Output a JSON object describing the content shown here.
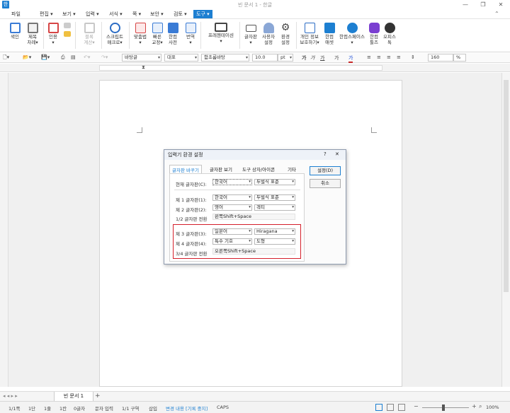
{
  "window": {
    "title": "빈 문서 1 - 한글"
  },
  "menu": [
    {
      "label": "파일"
    },
    {
      "label": "편집 ▾"
    },
    {
      "label": "보기 ▾"
    },
    {
      "label": "입력 ▾"
    },
    {
      "label": "서식 ▾"
    },
    {
      "label": "쪽 ▾"
    },
    {
      "label": "보안 ▾"
    },
    {
      "label": "검토 ▾"
    },
    {
      "label": "도구 ▾"
    }
  ],
  "ribbon": [
    {
      "label": "색인",
      "icon": "index-icon",
      "color": "#3a7bd5"
    },
    {
      "label": "제목\n차례▾",
      "icon": "toc-icon",
      "color": "#6a6a6a"
    },
    {
      "label": "인용\n▾",
      "icon": "quote-icon",
      "color": "#d64545"
    },
    {
      "label": "블록\n계산▾",
      "icon": "block-calc-icon",
      "color": "#b8b8b8"
    },
    {
      "label": "스크립트\n매크로▾",
      "icon": "script-icon",
      "color": "#2b6cc4"
    },
    {
      "label": "맞춤법\n▾",
      "icon": "spellcheck-icon",
      "color": "#d64545"
    },
    {
      "label": "빠른\n교정▾",
      "icon": "quick-correct-icon",
      "color": "#3a7bd5"
    },
    {
      "label": "한컴\n사전",
      "icon": "dictionary-icon",
      "color": "#3a7bd5"
    },
    {
      "label": "번역\n▾",
      "icon": "translate-icon",
      "color": "#3a7bd5"
    },
    {
      "label": "프레젠테이션\n▾",
      "icon": "presentation-icon",
      "color": "#444444"
    },
    {
      "label": "글자판\n▾",
      "icon": "keyboard-icon",
      "color": "#555555"
    },
    {
      "label": "사용자\n설정",
      "icon": "user-settings-icon",
      "color": "#3a7bd5"
    },
    {
      "label": "환경\n설정",
      "icon": "gear-icon",
      "color": "#444444"
    },
    {
      "label": "개인 정보\n보호하기▾",
      "icon": "privacy-icon",
      "color": "#2b6cc4"
    },
    {
      "label": "한컴\n애셋",
      "icon": "hancom-asset-icon",
      "color": "#1d7fd1"
    },
    {
      "label": "한컴스페이스\n▾",
      "icon": "hancom-space-icon",
      "color": "#1d7fd1"
    },
    {
      "label": "한컴\n툴즈",
      "icon": "hancom-tools-icon",
      "color": "#7a3fd1"
    },
    {
      "label": "오피스\n톡",
      "icon": "office-talk-icon",
      "color": "#333333"
    }
  ],
  "format": {
    "style": "바탕글",
    "lang": "대표",
    "font": "함초롬바탕",
    "size": "10.0",
    "unit": "pt",
    "zoom": "160",
    "zoom_unit": "%",
    "bold": "가",
    "italic": "가",
    "underline": "가",
    "strike": "가",
    "color": "가"
  },
  "tabs": {
    "doc": "빈 문서 1",
    "add": "+"
  },
  "status": [
    "1/1쪽",
    "1단",
    "1줄",
    "1칸",
    "0글자",
    "문자 입력",
    "1/1 구역",
    "삽입",
    "변경 내용 [기록 중지]",
    "CAPS"
  ],
  "status_zoom": "100%",
  "dialog": {
    "title": "입력기 환경 설정",
    "help": "?",
    "close": "✕",
    "tabs": [
      "글자판 바꾸기",
      "글자판 보기",
      "도구 상자/아이콘",
      "기타"
    ],
    "current_label": "현재 글자판(C):",
    "current_lang": "한국어",
    "current_layout": "두벌식 표준",
    "kb1_label": "제 1 글자판(1):",
    "kb1_lang": "한국어",
    "kb1_layout": "두벌식 표준",
    "kb2_label": "제 2 글자판(2):",
    "kb2_lang": "영어",
    "kb2_layout": "쿼티",
    "switch12_label": "1/2 글자판 전환",
    "switch12_value": "왼쪽Shift+Space",
    "kb3_label": "제 3 글자판(3):",
    "kb3_lang": "일본어",
    "kb3_layout": "Hiragana",
    "kb4_label": "제 4 글자판(4):",
    "kb4_lang": "특수 기호",
    "kb4_layout": "도형",
    "switch34_label": "3/4 글자판 전환",
    "switch34_value": "오른쪽Shift+Space",
    "ok": "설정(D)",
    "cancel": "취소",
    "highlight_color": "#d41f2b"
  }
}
